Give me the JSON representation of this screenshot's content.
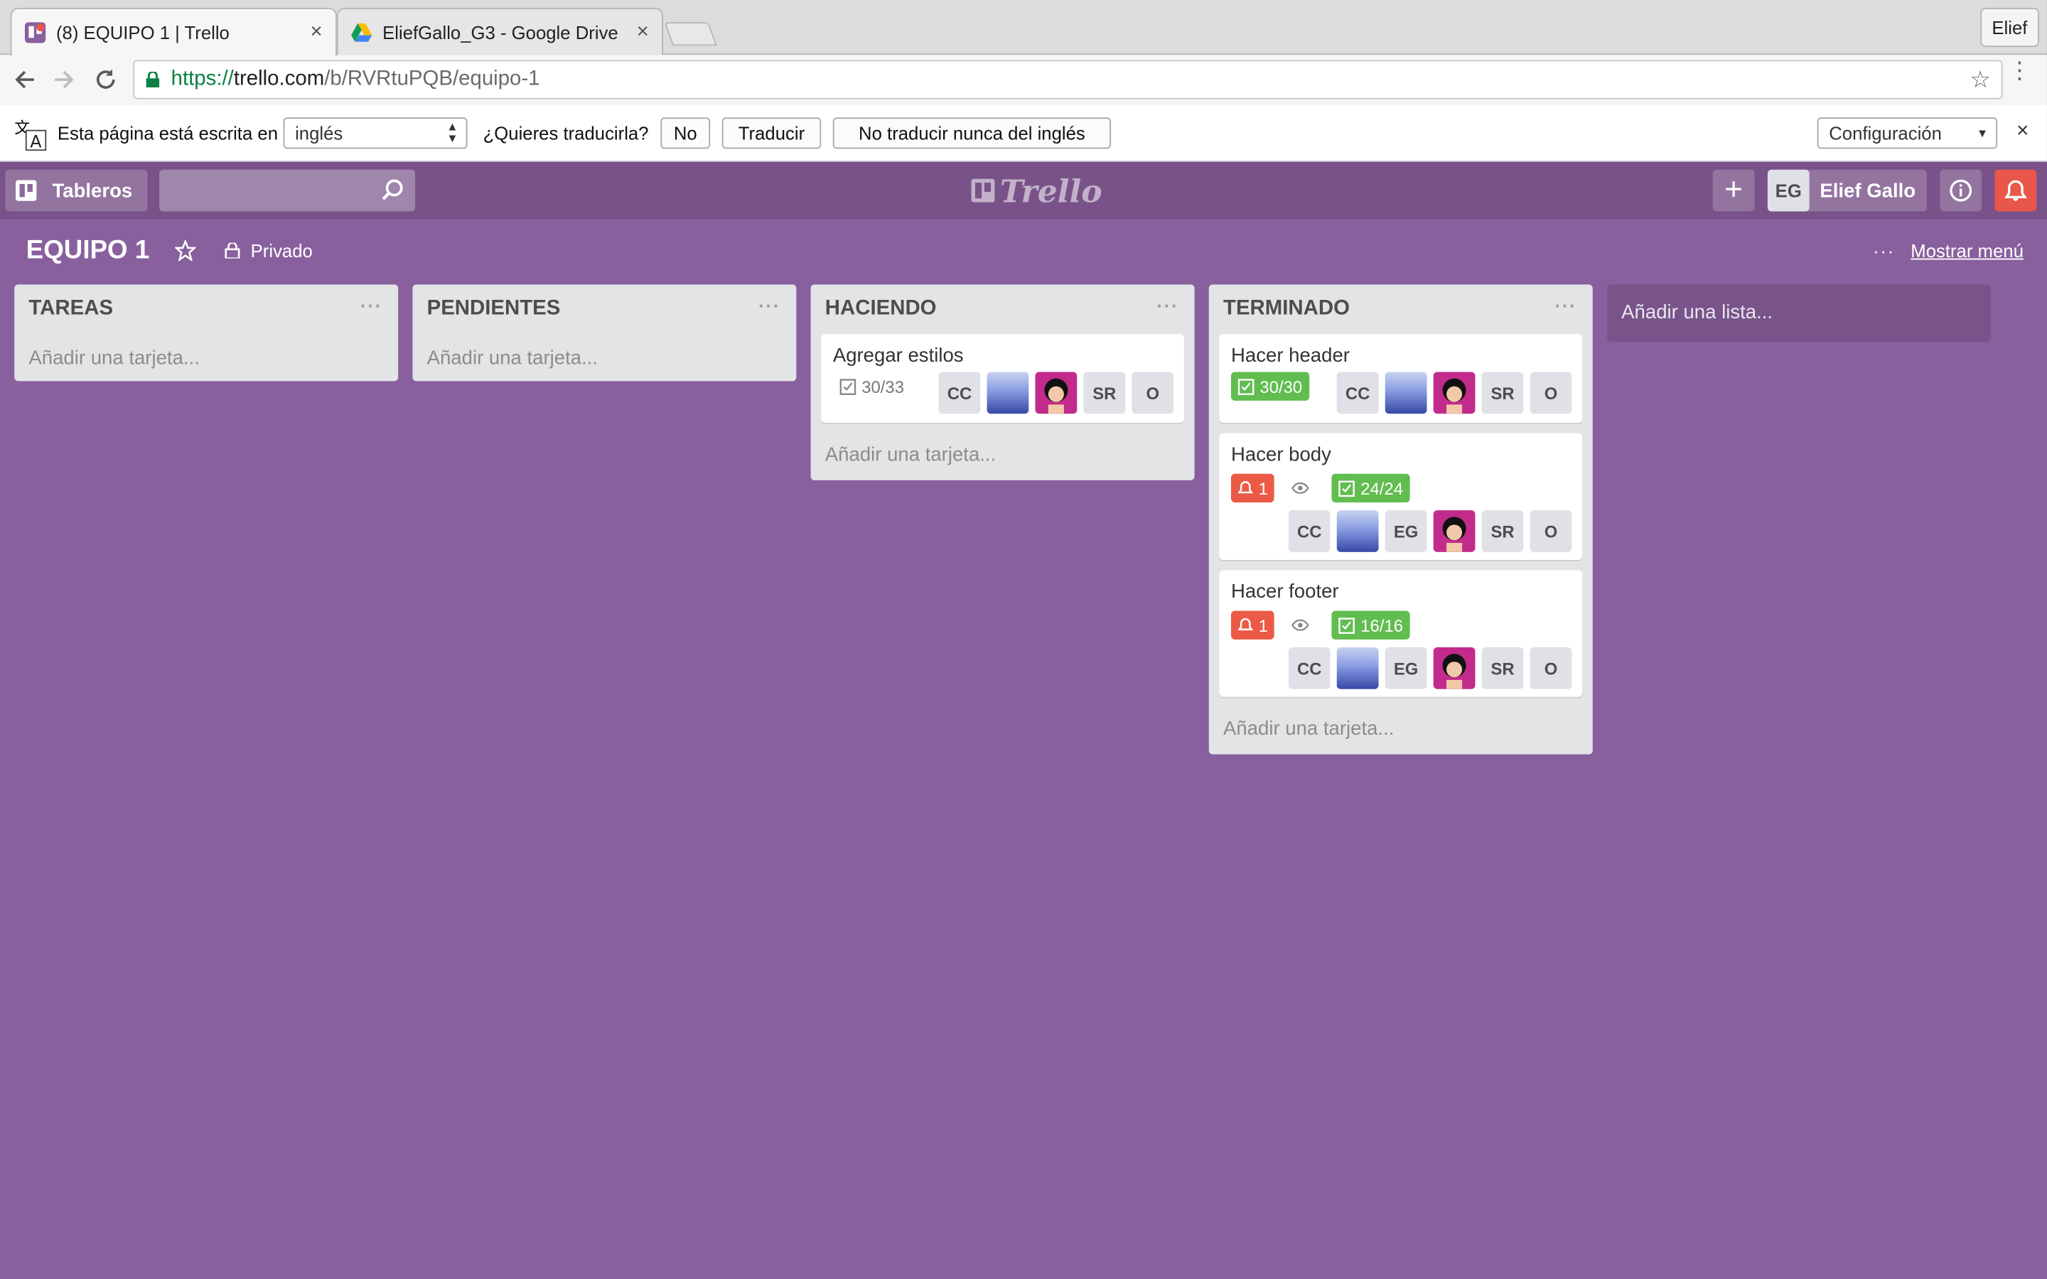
{
  "browser": {
    "tabs": [
      {
        "title": "(8) EQUIPO 1 | Trello",
        "close": "×"
      },
      {
        "title": "EliefGallo_G3 - Google Drive",
        "close": "×"
      }
    ],
    "profile": "Elief",
    "url": {
      "scheme": "https://",
      "host": "trello.com",
      "path": "/b/RVRtuPQB/equipo-1"
    }
  },
  "translate_bar": {
    "text": "Esta página está escrita en",
    "language": "inglés",
    "question": "¿Quieres traducirla?",
    "no": "No",
    "translate": "Traducir",
    "never": "No traducir nunca del inglés",
    "config": "Configuración",
    "close": "×"
  },
  "header": {
    "boards": "Tableros",
    "logo": "Trello",
    "add": "+",
    "user_initials": "EG",
    "user_name": "Elief Gallo"
  },
  "board": {
    "title": "EQUIPO 1",
    "visibility": "Privado",
    "menu_dots": "···",
    "show_menu": "Mostrar menú",
    "add_list": "Añadir una lista..."
  },
  "lists": [
    {
      "title": "TAREAS",
      "menu": "···",
      "add_card": "Añadir una tarjeta..."
    },
    {
      "title": "PENDIENTES",
      "menu": "···",
      "add_card": "Añadir una tarjeta..."
    },
    {
      "title": "HACIENDO",
      "menu": "···",
      "add_card": "Añadir una tarjeta...",
      "cards": [
        {
          "title": "Agregar estilos",
          "checklist": "30/33",
          "members": [
            "CC",
            "SR",
            "O"
          ]
        }
      ]
    },
    {
      "title": "TERMINADO",
      "menu": "···",
      "add_card": "Añadir una tarjeta...",
      "cards": [
        {
          "title": "Hacer header",
          "checklist": "30/30",
          "members": [
            "CC",
            "SR",
            "O"
          ]
        },
        {
          "title": "Hacer body",
          "notifications": "1",
          "checklist": "24/24",
          "members": [
            "CC",
            "EG",
            "SR",
            "O"
          ]
        },
        {
          "title": "Hacer footer",
          "notifications": "1",
          "checklist": "16/16",
          "members": [
            "CC",
            "EG",
            "SR",
            "O"
          ]
        }
      ]
    }
  ],
  "colors": {
    "board_bg": "#89609e",
    "header_bg": "#785288",
    "green_badge": "#61bd4f",
    "red_badge": "#eb5a46",
    "notification_bell": "#e8574a"
  }
}
